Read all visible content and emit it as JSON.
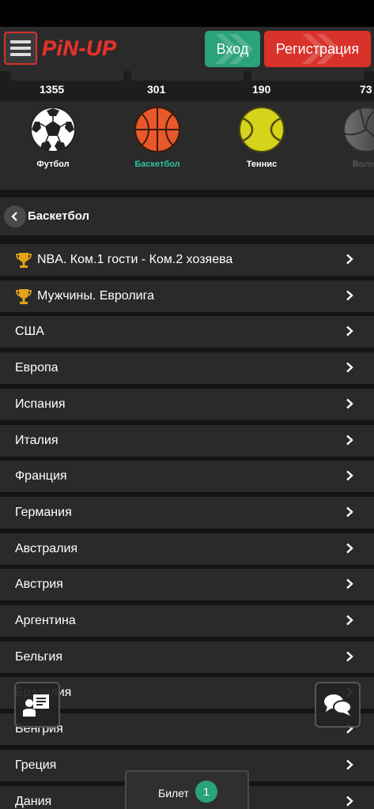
{
  "header": {
    "logo_text": "PiN-UP",
    "login_label": "Вход",
    "register_label": "Регистрация"
  },
  "sport_counts": [
    "1355",
    "301",
    "190",
    "73"
  ],
  "sports": [
    {
      "label": "Футбол",
      "icon": "soccer-ball-icon"
    },
    {
      "label": "Баскетбол",
      "icon": "basketball-icon",
      "active": true
    },
    {
      "label": "Теннис",
      "icon": "tennis-ball-icon"
    },
    {
      "label": "Волей",
      "icon": "volleyball-icon"
    }
  ],
  "section": {
    "title": "Баскетбол"
  },
  "leagues": [
    {
      "label": "NBA. Ком.1 гости - Ком.2 хозяева",
      "trophy": true
    },
    {
      "label": "Мужчины. Евролига",
      "trophy": true
    },
    {
      "label": "США"
    },
    {
      "label": "Европа"
    },
    {
      "label": "Испания"
    },
    {
      "label": "Италия"
    },
    {
      "label": "Франция"
    },
    {
      "label": "Германия"
    },
    {
      "label": "Австралия"
    },
    {
      "label": "Австрия"
    },
    {
      "label": "Аргентина"
    },
    {
      "label": "Бельгия"
    },
    {
      "label": "Бразилия"
    },
    {
      "label": "Венгрия"
    },
    {
      "label": "Греция"
    },
    {
      "label": "Дания"
    }
  ],
  "ticket": {
    "label": "Билет",
    "count": "1"
  },
  "colors": {
    "brand_red": "#d8322a",
    "accent_green": "#2aa27a",
    "row_bg": "#2a2a2a",
    "page_bg": "#141414"
  }
}
